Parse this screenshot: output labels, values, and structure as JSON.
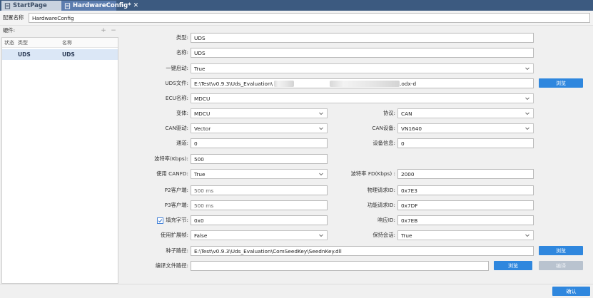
{
  "tabs": [
    {
      "label": "StartPage",
      "icon": "document-icon"
    },
    {
      "label": "HardwareConfig*",
      "icon": "document-icon",
      "close": "✕"
    }
  ],
  "config": {
    "label": "配置名称",
    "value": "HardwareConfig"
  },
  "hardware": {
    "label": "硬件:",
    "add": "+",
    "remove": "−",
    "columns": [
      "状态",
      "类型",
      "名称"
    ],
    "rows": [
      {
        "status": "",
        "type": "UDS",
        "name": "UDS"
      }
    ]
  },
  "form": {
    "type": {
      "label": "类型:",
      "value": "UDS"
    },
    "name": {
      "label": "名称:",
      "value": "UDS"
    },
    "oneclick": {
      "label": "一键启动:",
      "value": "True"
    },
    "udsfile": {
      "label": "UDS文件:",
      "prefix": "E:\\Test\\v0.9.3\\Uds_Evaluation\\",
      "suffix": ".odx-d",
      "browse": "浏览"
    },
    "ecu": {
      "label": "ECU名称:",
      "value": "MDCU"
    },
    "variant": {
      "label": "变体:",
      "value": "MDCU"
    },
    "protocol": {
      "label": "协议:",
      "value": "CAN"
    },
    "candriver": {
      "label": "CAN驱动:",
      "value": "Vector"
    },
    "candevice": {
      "label": "CAN设备:",
      "value": "VN1640"
    },
    "channel": {
      "label": "通道:",
      "value": "0"
    },
    "deviceinfo": {
      "label": "设备信息:",
      "value": "0"
    },
    "baud": {
      "label": "波特率(Kbps):",
      "value": "500"
    },
    "canfd": {
      "label": "使用 CANFD:",
      "value": "True"
    },
    "fdbaud": {
      "label": "波特率 FD(Kbps) :",
      "value": "2000"
    },
    "p2": {
      "label": "P2客户端:",
      "value": "500 ms"
    },
    "physid": {
      "label": "物理请求ID:",
      "value": "0x7E3"
    },
    "p3": {
      "label": "P3客户端:",
      "value": "500 ms"
    },
    "funcid": {
      "label": "功能请求ID:",
      "value": "0x7DF"
    },
    "fill": {
      "label": "填充字节:",
      "value": "0x0",
      "checked": true
    },
    "respid": {
      "label": "响应ID:",
      "value": "0x7EB"
    },
    "extframe": {
      "label": "使用扩展帧:",
      "value": "False"
    },
    "keepalive": {
      "label": "保持会话:",
      "value": "True"
    },
    "seedpath": {
      "label": "种子路径:",
      "value": "E:\\Test\\v0.9.3\\Uds_Evaluation\\ComSeedKey\\SeednKey.dll",
      "browse": "浏览"
    },
    "compilepath": {
      "label": "编译文件路径:",
      "value": "",
      "browse": "浏览",
      "compile": "编译"
    }
  },
  "confirm": "确认",
  "colors": {
    "accent": "#2f87de",
    "tabbar": "#3c5a80",
    "selected_row": "#dbe7f6"
  }
}
